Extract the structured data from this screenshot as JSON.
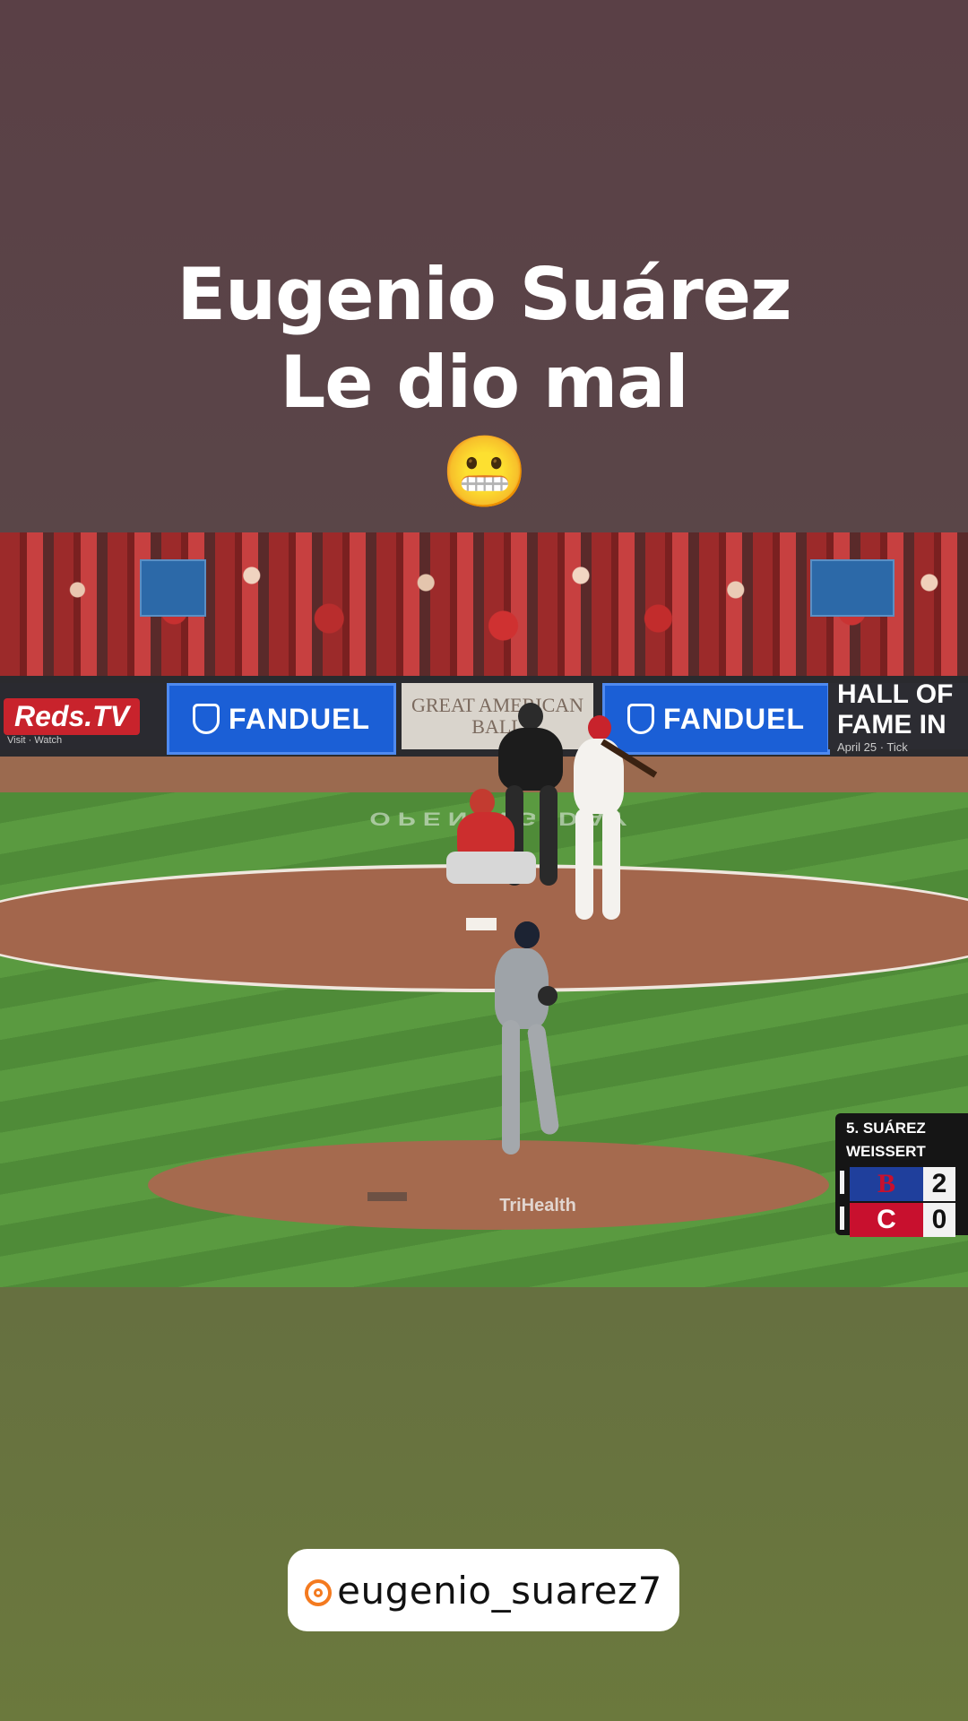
{
  "caption": {
    "line1": "Eugenio Suárez",
    "line2": "Le dio mal",
    "emoji": "😬"
  },
  "video": {
    "boards": {
      "reds": "Reds.TV",
      "reds_sub": "Visit  ·  Watch",
      "fanduel": "FANDUEL",
      "great_line1": "GREAT AMERICAN",
      "great_line2": "BALL",
      "hall": "HALL OF FAME IN",
      "hall_sub": "April 25  ·  Tick"
    },
    "mound_logo": "TriHealth",
    "scorebug": {
      "batter": "5. SUÁREZ",
      "pitcher": "WEISSERT",
      "away_logo": "B",
      "away_score": "2",
      "home_logo": "C",
      "home_score": "0",
      "away_color": "#1f3f9c",
      "home_color": "#c8102e"
    }
  },
  "handle": {
    "icon": "threads-icon",
    "text": "eugenio_suarez7",
    "accent": "#f47a1f"
  }
}
